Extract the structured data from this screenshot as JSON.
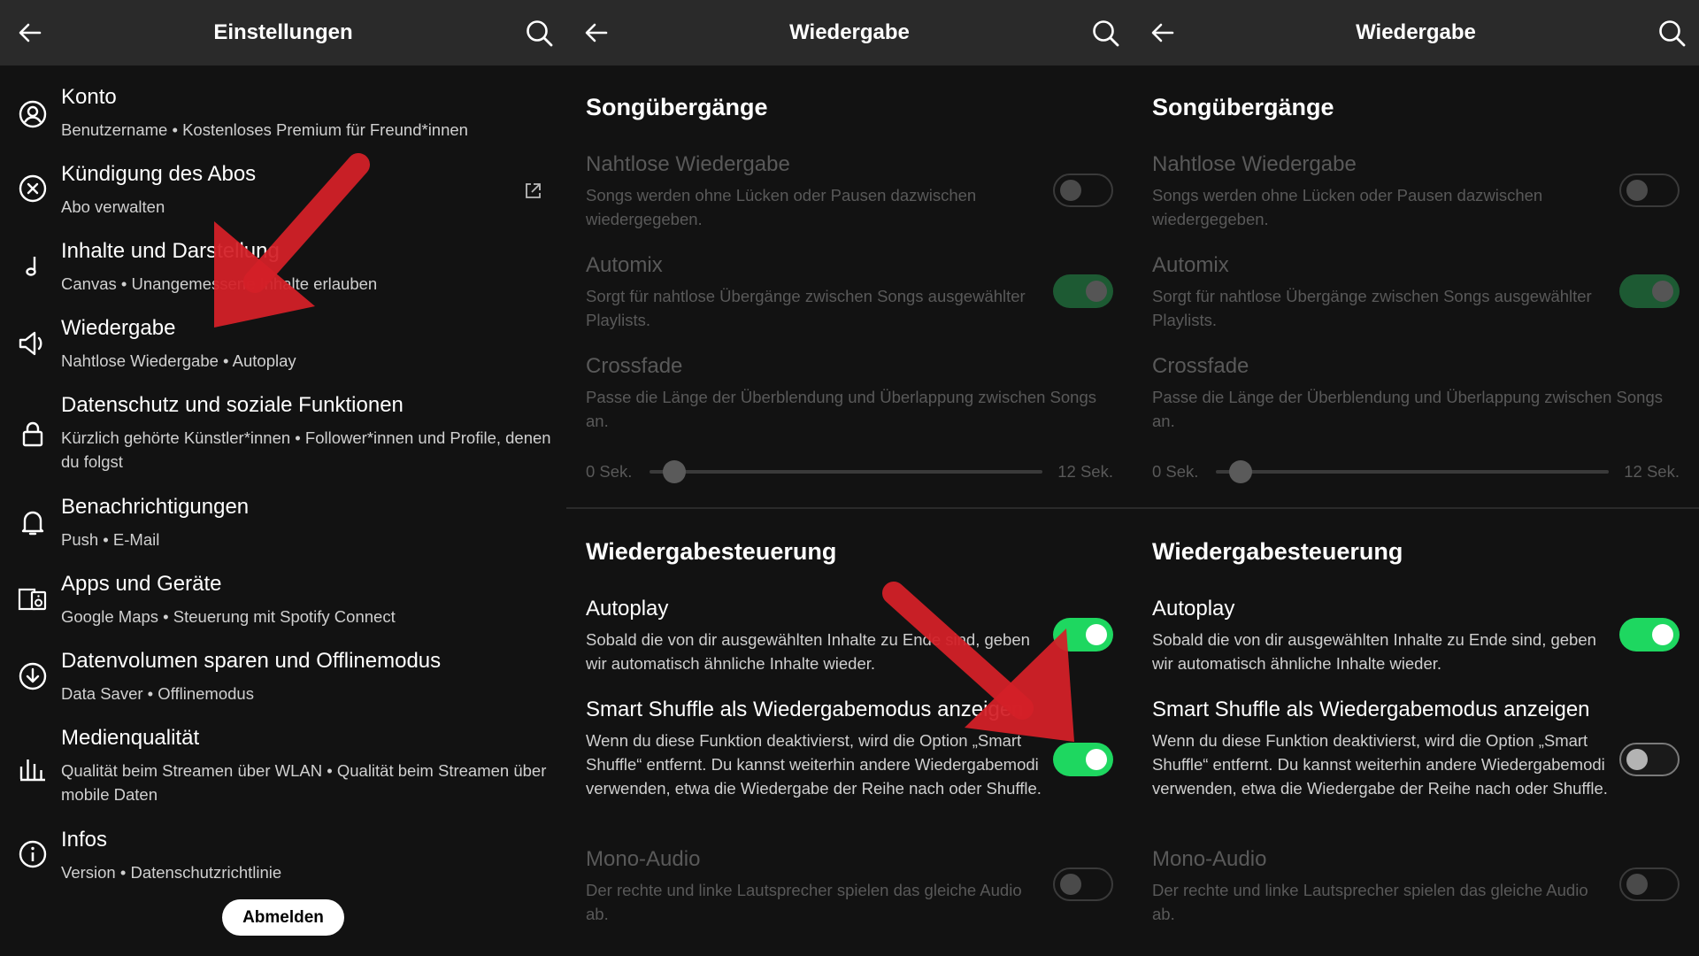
{
  "colors": {
    "accent": "#1ed760",
    "background": "#121212",
    "topbar": "#2a2a2a",
    "arrow": "#d32027"
  },
  "settings": {
    "title": "Einstellungen",
    "back_icon": "arrow-left-icon",
    "search_icon": "search-icon",
    "items": [
      {
        "icon": "user-circle-icon",
        "title": "Konto",
        "subtitle": "Benutzername • Kostenloses Premium für Freund*innen"
      },
      {
        "icon": "x-circle-icon",
        "title": "Kündigung des Abos",
        "subtitle": "Abo verwalten",
        "trailing_icon": "external-link-icon"
      },
      {
        "icon": "music-note-icon",
        "title": "Inhalte und Darstellung",
        "subtitle": "Canvas • Unangemessene Inhalte erlauben"
      },
      {
        "icon": "speaker-icon",
        "title": "Wiedergabe",
        "subtitle": "Nahtlose Wiedergabe • Autoplay"
      },
      {
        "icon": "lock-icon",
        "title": "Datenschutz und soziale Funktionen",
        "subtitle": "Kürzlich gehörte Künstler*innen • Follower*innen und Profile, denen du folgst"
      },
      {
        "icon": "bell-icon",
        "title": "Benachrichtigungen",
        "subtitle": "Push • E-Mail"
      },
      {
        "icon": "devices-icon",
        "title": "Apps und Geräte",
        "subtitle": "Google Maps • Steuerung mit Spotify Connect"
      },
      {
        "icon": "download-circle-icon",
        "title": "Datenvolumen sparen und Offlinemodus",
        "subtitle": "Data Saver • Offlinemodus"
      },
      {
        "icon": "equalizer-icon",
        "title": "Medienqualität",
        "subtitle": "Qualität beim Streamen über WLAN • Qualität beim Streamen über mobile Daten"
      },
      {
        "icon": "info-icon",
        "title": "Infos",
        "subtitle": "Version • Datenschutzrichtlinie"
      }
    ],
    "logout_label": "Abmelden"
  },
  "playback_before": {
    "title": "Wiedergabe",
    "section1": "Songübergänge",
    "gapless": {
      "title": "Nahtlose Wiedergabe",
      "desc": "Songs werden ohne Lücken oder Pausen dazwischen wiedergegeben.",
      "state": "off",
      "enabled": false
    },
    "automix": {
      "title": "Automix",
      "desc": "Sorgt für nahtlose Übergänge zwischen Songs ausgewählter Playlists.",
      "state": "on",
      "enabled": false
    },
    "crossfade": {
      "title": "Crossfade",
      "desc": "Passe die Länge der Überblendung und Überlappung zwischen Songs an.",
      "min_label": "0 Sek.",
      "max_label": "12 Sek.",
      "value_seconds": 1,
      "max_seconds": 12
    },
    "section2": "Wiedergabesteuerung",
    "autoplay": {
      "title": "Autoplay",
      "desc": "Sobald die von dir ausgewählten Inhalte zu Ende sind, geben wir automatisch ähnliche Inhalte wieder.",
      "state": "on"
    },
    "smart_shuffle": {
      "title": "Smart Shuffle als Wiedergabemodus anzeigen",
      "desc": "Wenn du diese Funktion deaktivierst, wird die Option „Smart Shuffle“ entfernt. Du kannst weiterhin andere Wiedergabemodi verwenden, etwa die Wiedergabe der Reihe nach oder Shuffle.",
      "state": "on"
    },
    "mono": {
      "title": "Mono-Audio",
      "desc": "Der rechte und linke Lautsprecher spielen das gleiche Audio ab.",
      "state": "off",
      "enabled": false
    }
  },
  "playback_after": {
    "title": "Wiedergabe",
    "section1": "Songübergänge",
    "gapless": {
      "title": "Nahtlose Wiedergabe",
      "desc": "Songs werden ohne Lücken oder Pausen dazwischen wiedergegeben.",
      "state": "off",
      "enabled": false
    },
    "automix": {
      "title": "Automix",
      "desc": "Sorgt für nahtlose Übergänge zwischen Songs ausgewählter Playlists.",
      "state": "on",
      "enabled": false
    },
    "crossfade": {
      "title": "Crossfade",
      "desc": "Passe die Länge der Überblendung und Überlappung zwischen Songs an.",
      "min_label": "0 Sek.",
      "max_label": "12 Sek.",
      "value_seconds": 1,
      "max_seconds": 12
    },
    "section2": "Wiedergabesteuerung",
    "autoplay": {
      "title": "Autoplay",
      "desc": "Sobald die von dir ausgewählten Inhalte zu Ende sind, geben wir automatisch ähnliche Inhalte wieder.",
      "state": "on"
    },
    "smart_shuffle": {
      "title": "Smart Shuffle als Wiedergabemodus anzeigen",
      "desc": "Wenn du diese Funktion deaktivierst, wird die Option „Smart Shuffle“ entfernt. Du kannst weiterhin andere Wiedergabemodi verwenden, etwa die Wiedergabe der Reihe nach oder Shuffle.",
      "state": "off"
    },
    "mono": {
      "title": "Mono-Audio",
      "desc": "Der rechte und linke Lautsprecher spielen das gleiche Audio ab.",
      "state": "off",
      "enabled": false
    }
  }
}
